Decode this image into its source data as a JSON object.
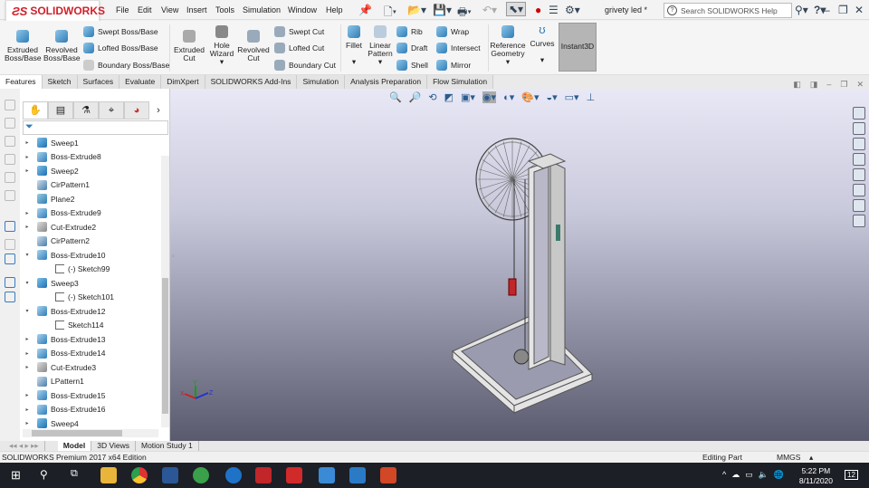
{
  "app": {
    "brand": "SOLIDWORKS",
    "doc_title": "grivety led *",
    "search_placeholder": "Search SOLIDWORKS Help"
  },
  "menu": [
    "File",
    "Edit",
    "View",
    "Insert",
    "Tools",
    "Simulation",
    "Window",
    "Help"
  ],
  "ribbon": {
    "large": [
      {
        "label": "Extruded Boss/Base"
      },
      {
        "label": "Revolved Boss/Base"
      },
      {
        "label": "Extruded Cut"
      },
      {
        "label": "Hole Wizard"
      },
      {
        "label": "Revolved Cut"
      },
      {
        "label": "Fillet"
      },
      {
        "label": "Linear Pattern"
      },
      {
        "label": "Reference Geometry"
      },
      {
        "label": "Curves"
      }
    ],
    "small": [
      "Swept Boss/Base",
      "Lofted Boss/Base",
      "Boundary Boss/Base",
      "Swept Cut",
      "Lofted Cut",
      "Boundary Cut",
      "Rib",
      "Draft",
      "Shell",
      "Wrap",
      "Intersect",
      "Mirror"
    ],
    "instant3d": "Instant3D"
  },
  "command_tabs": [
    "Features",
    "Sketch",
    "Surfaces",
    "Evaluate",
    "DimXpert",
    "SOLIDWORKS Add-Ins",
    "Simulation",
    "Analysis Preparation",
    "Flow Simulation"
  ],
  "tree": [
    {
      "label": "Sweep1",
      "arrow": "▸",
      "type": "sweep",
      "indent": 0
    },
    {
      "label": "Boss-Extrude8",
      "arrow": "▸",
      "type": "boss",
      "indent": 0
    },
    {
      "label": "Sweep2",
      "arrow": "▸",
      "type": "sweep",
      "indent": 0
    },
    {
      "label": "CirPattern1",
      "arrow": "",
      "type": "pattern",
      "indent": 0
    },
    {
      "label": "Plane2",
      "arrow": "",
      "type": "plane",
      "indent": 0
    },
    {
      "label": "Boss-Extrude9",
      "arrow": "▸",
      "type": "boss",
      "indent": 0
    },
    {
      "label": "Cut-Extrude2",
      "arrow": "▸",
      "type": "cut",
      "indent": 0
    },
    {
      "label": "CirPattern2",
      "arrow": "",
      "type": "pattern",
      "indent": 0
    },
    {
      "label": "Boss-Extrude10",
      "arrow": "▾",
      "type": "boss",
      "indent": 0
    },
    {
      "label": "(-) Sketch99",
      "arrow": "",
      "type": "sketch",
      "indent": 1
    },
    {
      "label": "Sweep3",
      "arrow": "▾",
      "type": "sweep",
      "indent": 0
    },
    {
      "label": "(-) Sketch101",
      "arrow": "",
      "type": "sketch",
      "indent": 1
    },
    {
      "label": "Boss-Extrude12",
      "arrow": "▾",
      "type": "boss",
      "indent": 0
    },
    {
      "label": "Sketch114",
      "arrow": "",
      "type": "sketch",
      "indent": 1
    },
    {
      "label": "Boss-Extrude13",
      "arrow": "▸",
      "type": "boss",
      "indent": 0
    },
    {
      "label": "Boss-Extrude14",
      "arrow": "▸",
      "type": "boss",
      "indent": 0
    },
    {
      "label": "Cut-Extrude3",
      "arrow": "▸",
      "type": "cut",
      "indent": 0
    },
    {
      "label": "LPattern1",
      "arrow": "",
      "type": "pattern",
      "indent": 0
    },
    {
      "label": "Boss-Extrude15",
      "arrow": "▸",
      "type": "boss",
      "indent": 0
    },
    {
      "label": "Boss-Extrude16",
      "arrow": "▸",
      "type": "boss",
      "indent": 0
    },
    {
      "label": "Sweep4",
      "arrow": "▸",
      "type": "sweep",
      "indent": 0
    }
  ],
  "bottom_tabs": [
    "Model",
    "3D Views",
    "Motion Study 1"
  ],
  "status": {
    "edition": "SOLIDWORKS Premium 2017 x64 Edition",
    "mode": "Editing Part",
    "units": "MMGS"
  },
  "triad": {
    "x": "X",
    "y": "Y",
    "z": "Z"
  },
  "taskbar": {
    "time": "5:22 PM",
    "date": "8/11/2020",
    "notifications": "12"
  }
}
